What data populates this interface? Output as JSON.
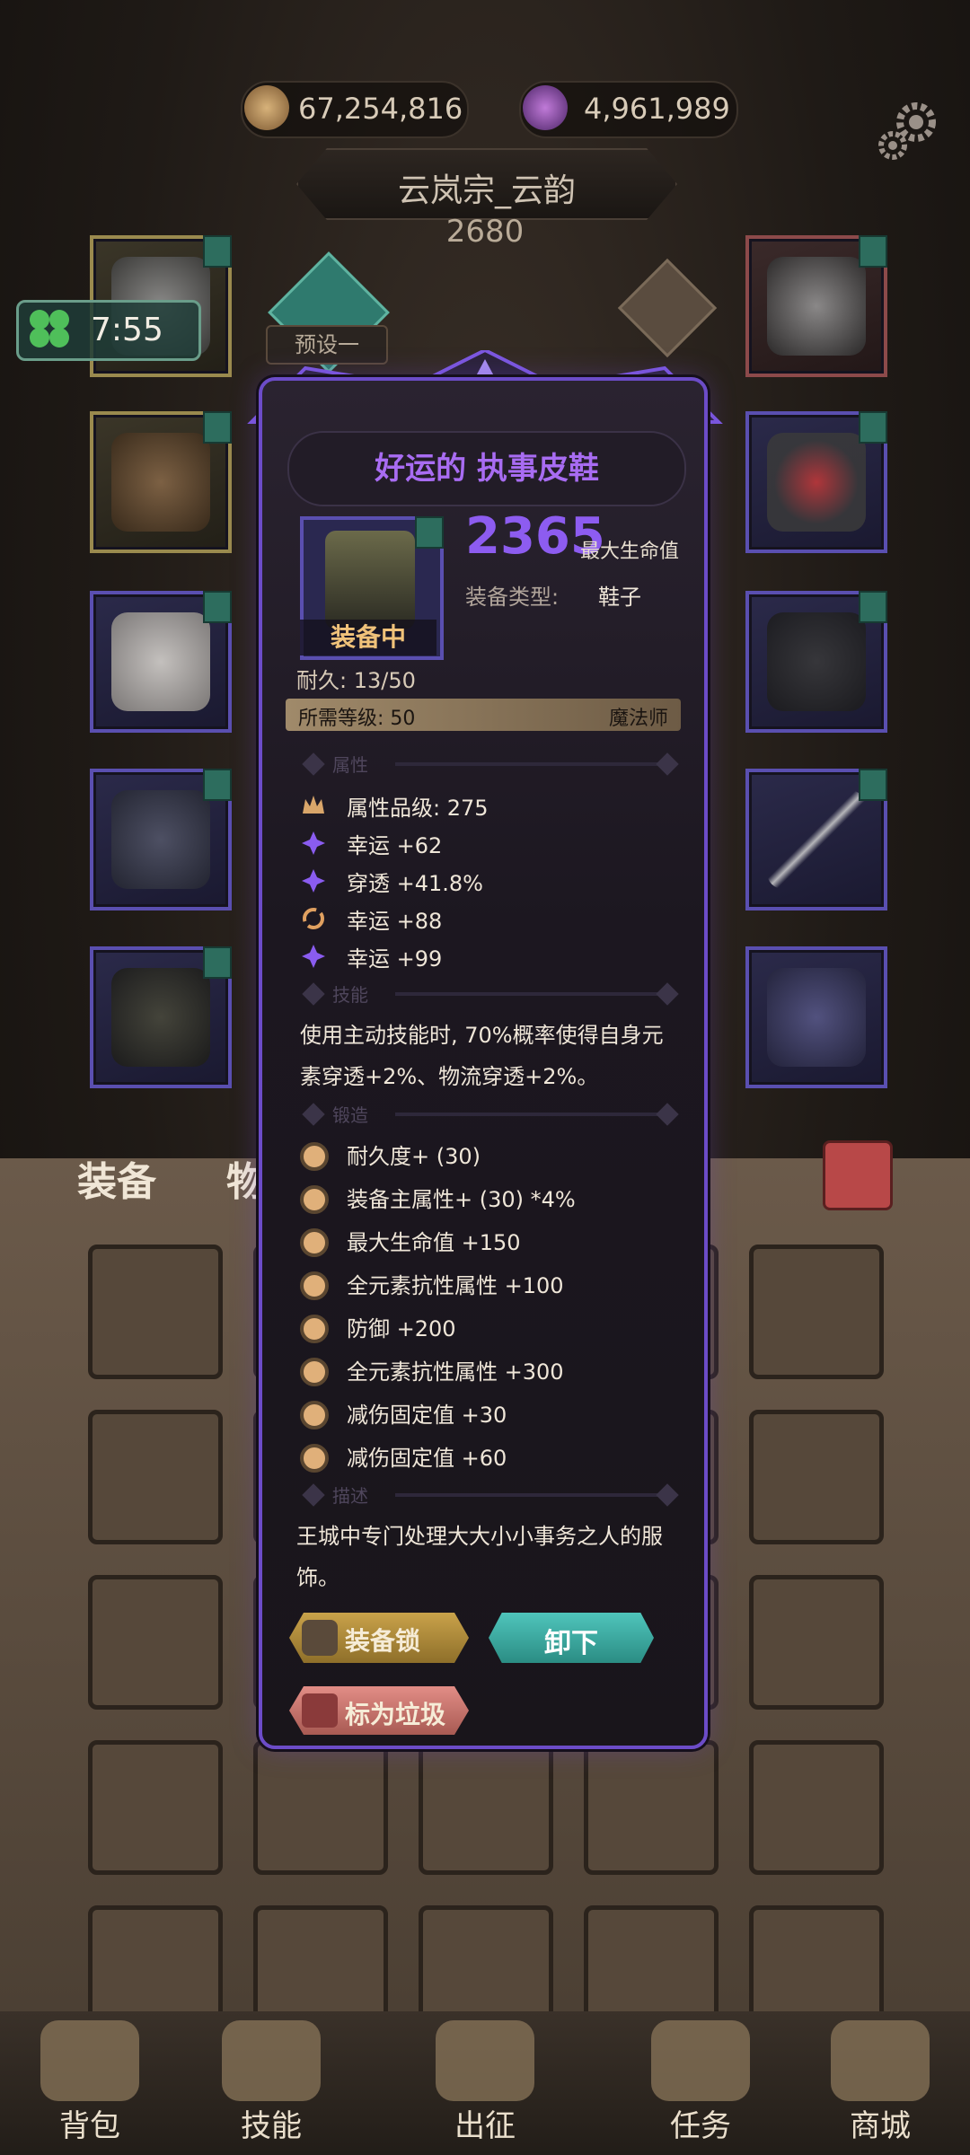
{
  "currency": {
    "coins": "67,254,816",
    "gems": "4,961,989"
  },
  "player": {
    "name": "云岚宗_云韵",
    "score": "2680"
  },
  "timer": "7:55",
  "preset_label": "预设一",
  "item": {
    "title": "好运的 执事皮鞋",
    "equipped_label": "装备中",
    "main_value": "2365",
    "main_value_label": "最大生命值",
    "type_label": "装备类型:",
    "type_value": "鞋子",
    "durability": "耐久: 13/50",
    "required_level": "所需等级: 50",
    "required_class": "魔法师",
    "sections": {
      "attributes": "属性",
      "skills": "技能",
      "forge": "锻造",
      "description": "描述"
    },
    "attributes": [
      {
        "icon": "crown-icon",
        "text": "属性品级: 275"
      },
      {
        "icon": "sparkle-icon",
        "text": "幸运 +62"
      },
      {
        "icon": "sparkle-icon",
        "text": "穿透 +41.8%"
      },
      {
        "icon": "cycle-icon",
        "text": "幸运 +88"
      },
      {
        "icon": "sparkle-icon",
        "text": "幸运 +99"
      }
    ],
    "skill": "使用主动技能时, 70%概率使得自身元素穿透+2%、物流穿透+2%。",
    "forge": [
      "耐久度+ (30)",
      "装备主属性+ (30) *4%",
      "最大生命值 +150",
      "全元素抗性属性 +100",
      "防御 +200",
      "全元素抗性属性 +300",
      "减伤固定值 +30",
      "减伤固定值 +60"
    ],
    "description": "王城中专门处理大大小小事务之人的服饰。",
    "buttons": {
      "lock": "装备锁",
      "unequip": "卸下",
      "trash": "标为垃圾"
    }
  },
  "bag_tabs": {
    "equipment": "装备",
    "items": "物品"
  },
  "nav": [
    "背包",
    "技能",
    "出征",
    "任务",
    "商城"
  ],
  "colors": {
    "accent_purple": "#8d5cf0",
    "title_purple": "#a86cf2",
    "equipped_gold": "#f0c27a",
    "unequip_teal": "#3fb0a7"
  }
}
